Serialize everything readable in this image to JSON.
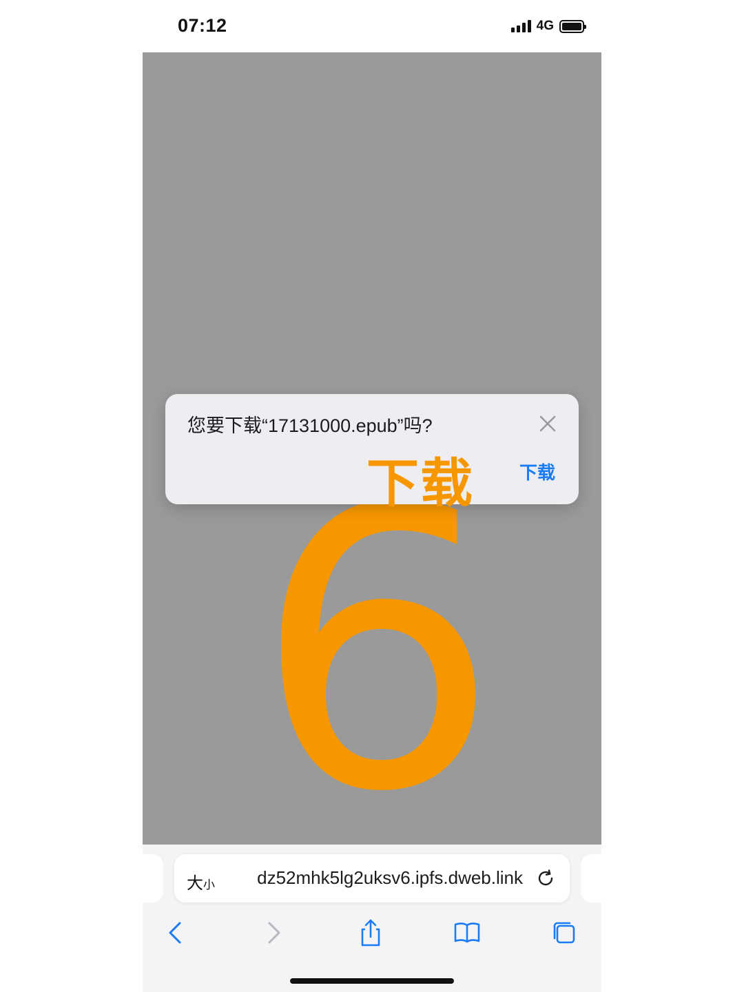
{
  "status_bar": {
    "time": "07:12",
    "network": "4G"
  },
  "page": {
    "big_digit": "6"
  },
  "download_prompt": {
    "question": "您要下载“17131000.epub”吗?",
    "overlay_label": "下载",
    "download_label": "下载"
  },
  "address_bar": {
    "text_size_label_large": "大",
    "text_size_label_small": "小",
    "url": "dz52mhk5lg2uksv6.ipfs.dweb.link"
  },
  "toolbar": {
    "icons": [
      "back-icon",
      "forward-icon",
      "share-icon",
      "bookmarks-icon",
      "tabs-icon"
    ]
  },
  "colors": {
    "accent_orange": "#f79700",
    "link_blue": "#1a7cf5",
    "content_gray": "#9a9a9a"
  }
}
